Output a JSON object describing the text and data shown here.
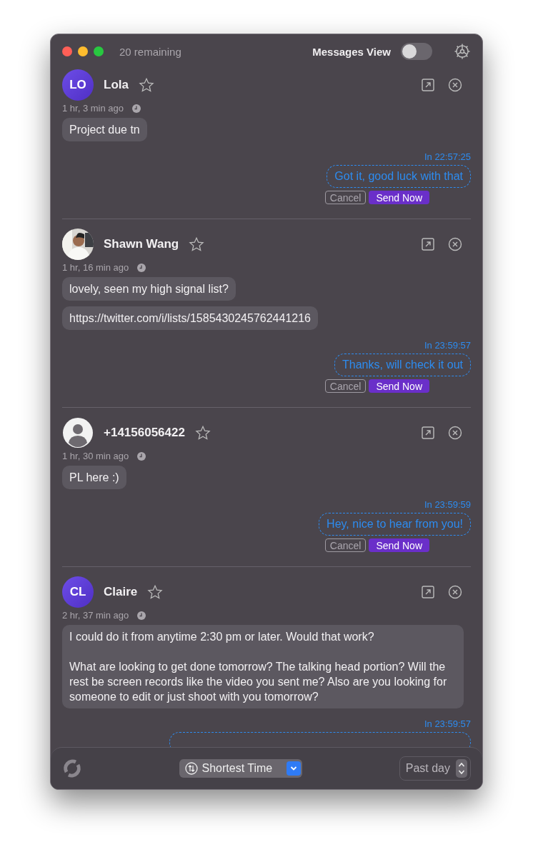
{
  "header": {
    "remaining": "20 remaining",
    "view_label": "Messages View",
    "view_on": false
  },
  "conversations": [
    {
      "avatar": {
        "kind": "initials",
        "initials": "LO"
      },
      "name": "Lola",
      "starred": false,
      "time_ago": "1 hr, 3 min ago",
      "messages": [
        "Project due tn"
      ],
      "reply": {
        "time": "In 22:57:25",
        "text": "Got it, good luck with that",
        "cancel": "Cancel",
        "send": "Send Now"
      }
    },
    {
      "name": "Shawn Wang",
      "starred": false,
      "time_ago": "1 hr, 16 min ago",
      "messages": [
        "lovely, seen my high signal list?",
        "https://twitter.com/i/lists/1585430245762441216"
      ],
      "reply": {
        "time": "In 23:59:57",
        "text": "Thanks, will check it out",
        "cancel": "Cancel",
        "send": "Send Now"
      }
    },
    {
      "avatar": {
        "kind": "placeholder"
      },
      "name": "+14156056422",
      "starred": false,
      "time_ago": "1 hr, 30 min ago",
      "messages": [
        "PL here :)"
      ],
      "reply": {
        "time": "In 23:59:59",
        "text": "Hey, nice to hear from you!",
        "cancel": "Cancel",
        "send": "Send Now"
      }
    },
    {
      "avatar": {
        "kind": "initials",
        "initials": "CL"
      },
      "name": "Claire",
      "starred": false,
      "time_ago": "2 hr, 37 min ago",
      "messages": [
        "I could do it from anytime 2:30 pm or later. Would that work?\n\nWhat are looking to get done tomorrow? The talking head portion? Will the rest be screen records like the video you sent me? Also are you looking for someone to edit or just shoot with you tomorrow?"
      ],
      "reply": {
        "time": "In 23:59:57"
      }
    }
  ],
  "footer": {
    "sort": "Shortest Time",
    "range": "Past day"
  }
}
